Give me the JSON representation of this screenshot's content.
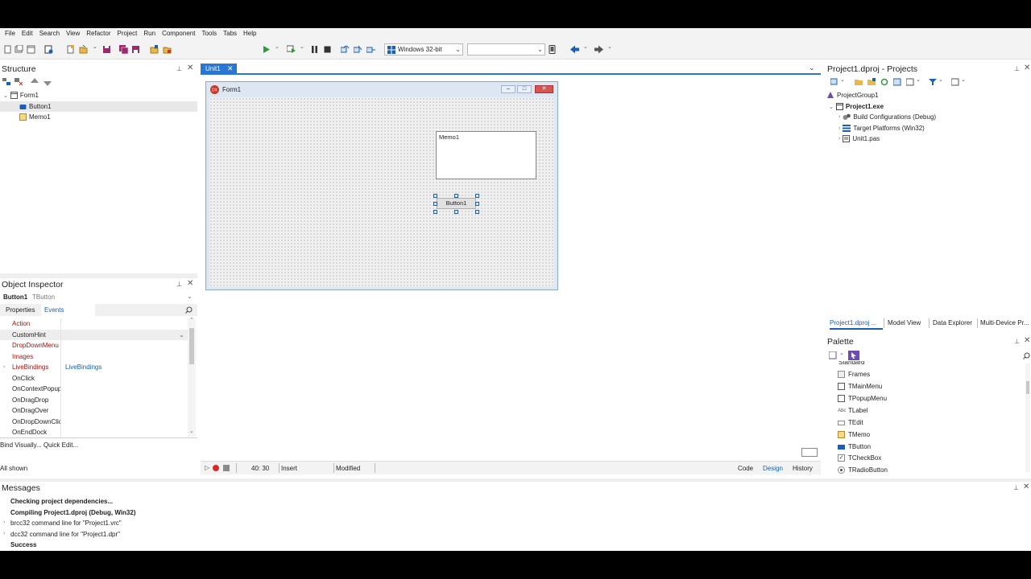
{
  "menu": [
    "File",
    "Edit",
    "Search",
    "View",
    "Refactor",
    "Project",
    "Run",
    "Component",
    "Tools",
    "Tabs",
    "Help"
  ],
  "toolbar": {
    "platform": "Windows 32-bit",
    "config": ""
  },
  "structure": {
    "title": "Structure",
    "items": [
      "Form1",
      "Button1",
      "Memo1"
    ]
  },
  "editor": {
    "tab": "Unit1",
    "form_caption": "Form1",
    "memo_text": "Memo1",
    "button_caption": "Button1",
    "status": {
      "position": "40:  30",
      "mode": "Insert",
      "state": "Modified"
    },
    "view_tabs": [
      "Code",
      "Design",
      "History"
    ]
  },
  "object_inspector": {
    "title": "Object Inspector",
    "object_name": "Button1",
    "object_type": "TButton",
    "tabs": [
      "Properties",
      "Events"
    ],
    "rows": [
      {
        "key": "Action",
        "value": "",
        "red": true
      },
      {
        "key": "CustomHint",
        "value": "",
        "red": false
      },
      {
        "key": "DropDownMenu",
        "value": "",
        "red": true
      },
      {
        "key": "Images",
        "value": "",
        "red": true
      },
      {
        "key": "LiveBindings",
        "value": "LiveBindings",
        "red": true
      },
      {
        "key": "OnClick",
        "value": "",
        "red": false
      },
      {
        "key": "OnContextPopup",
        "value": "",
        "red": false
      },
      {
        "key": "OnDragDrop",
        "value": "",
        "red": false
      },
      {
        "key": "OnDragOver",
        "value": "",
        "red": false
      },
      {
        "key": "OnDropDownClick",
        "value": "",
        "red": false
      },
      {
        "key": "OnEndDock",
        "value": "",
        "red": false
      }
    ],
    "links": "Bind Visually...  Quick Edit...",
    "footer": "All shown"
  },
  "projects": {
    "title": "Project1.dproj - Projects",
    "items": [
      "ProjectGroup1",
      "Project1.exe",
      "Build Configurations (Debug)",
      "Target Platforms (Win32)",
      "Unit1.pas"
    ],
    "tabs": [
      "Project1.dproj ...",
      "Model View",
      "Data Explorer",
      "Multi-Device Pr..."
    ]
  },
  "palette": {
    "title": "Palette",
    "category": "Standard",
    "items": [
      "Frames",
      "TMainMenu",
      "TPopupMenu",
      "TLabel",
      "TEdit",
      "TMemo",
      "TButton",
      "TCheckBox",
      "TRadioButton"
    ]
  },
  "messages": {
    "title": "Messages",
    "lines": [
      {
        "text": "Checking project dependencies...",
        "bold": true
      },
      {
        "text": "Compiling Project1.dproj (Debug, Win32)",
        "bold": true
      },
      {
        "text": "brcc32 command line for \"Project1.vrc\"",
        "bold": false
      },
      {
        "text": "dcc32 command line for \"Project1.dpr\"",
        "bold": false
      },
      {
        "text": "Success",
        "bold": true
      }
    ]
  },
  "colors": {
    "accent": "#1a5fb4",
    "tab_active": "#2a76d2",
    "red_prop": "#b01010",
    "close_btn": "#d9534f"
  }
}
